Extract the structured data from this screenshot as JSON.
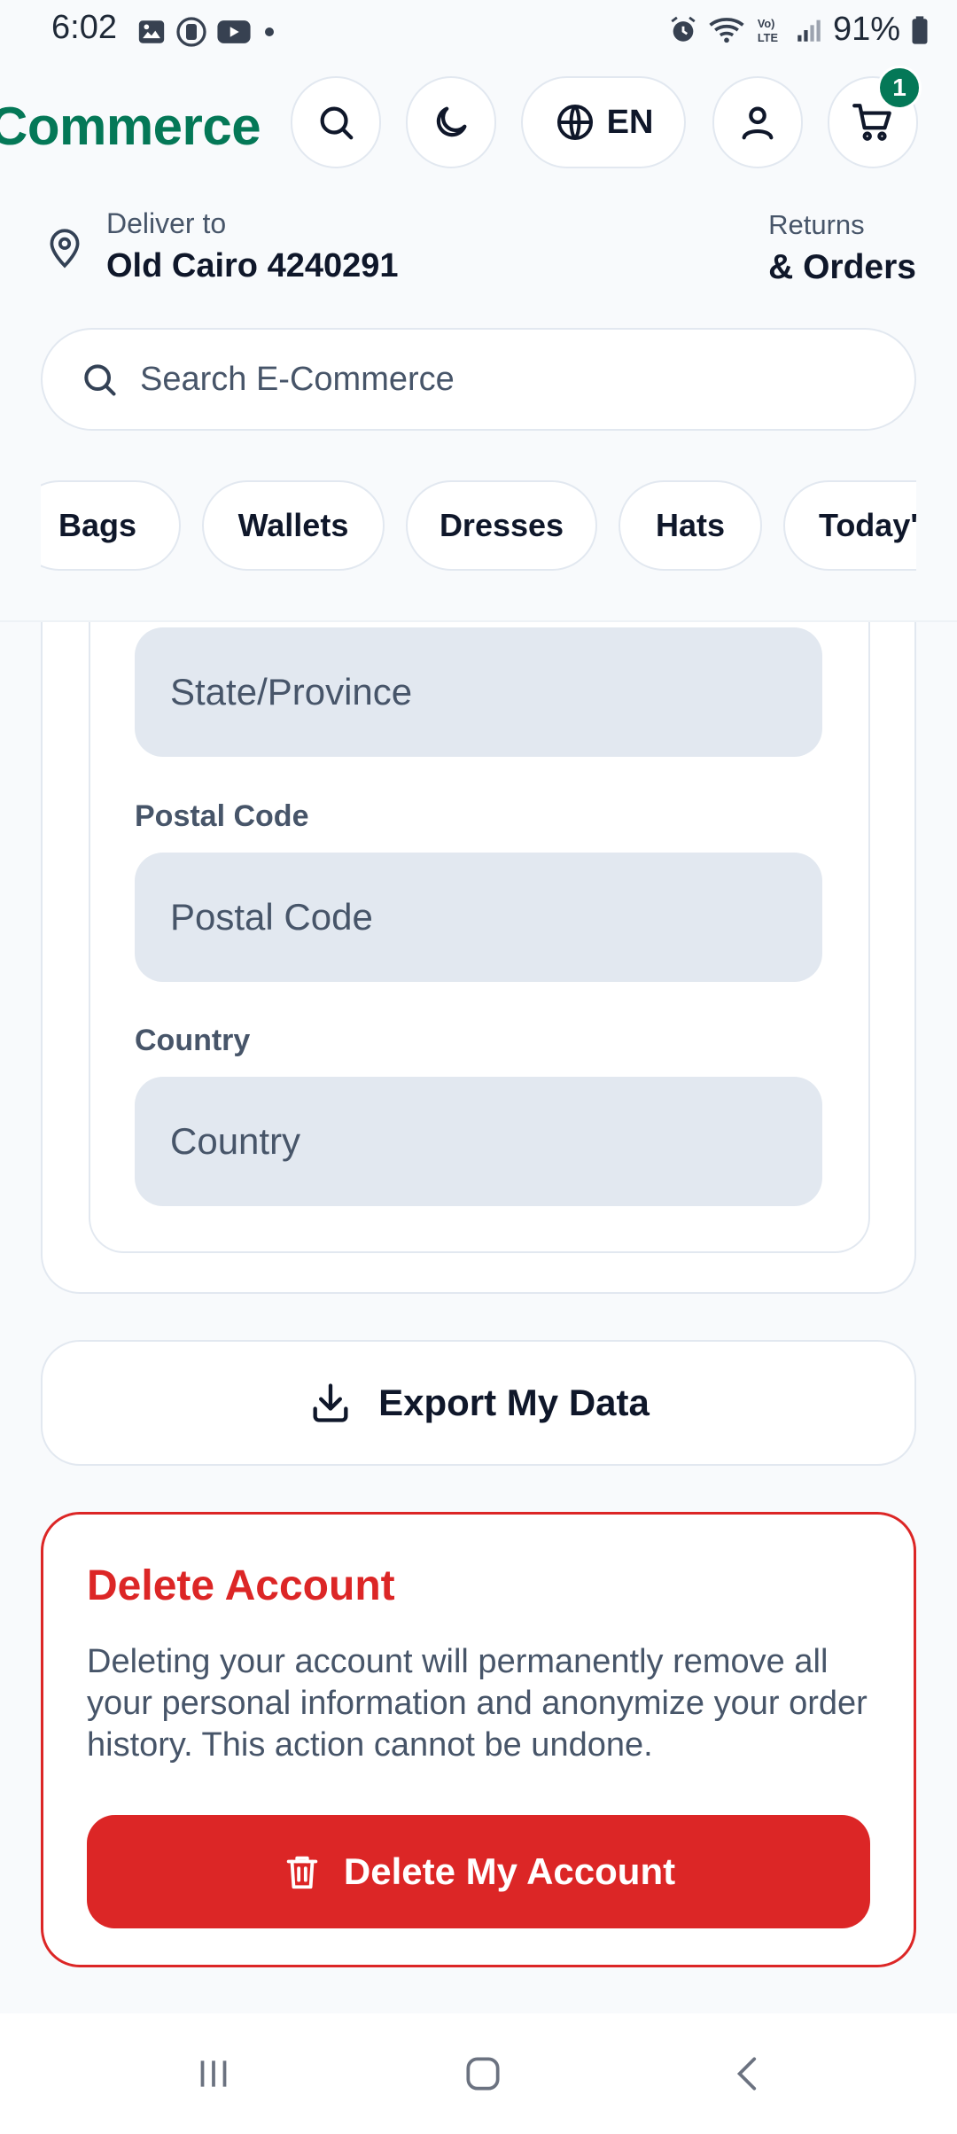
{
  "status_bar": {
    "time": "6:02",
    "battery": "91%",
    "icons": [
      "image-icon",
      "assistant-icon",
      "youtube-icon",
      "dot-icon",
      "alarm-icon",
      "wifi-icon",
      "volte-icon",
      "signal-icon",
      "battery-icon"
    ]
  },
  "header": {
    "brand": "Commerce",
    "language": "EN",
    "cart_count": "1",
    "deliver_label": "Deliver to",
    "deliver_location": "Old Cairo 4240291",
    "returns_label": "Returns",
    "orders_label": "& Orders",
    "search_placeholder": "Search E-Commerce",
    "categories": [
      "Bags",
      "Wallets",
      "Dresses",
      "Hats",
      "Today's"
    ]
  },
  "address_form": {
    "state": {
      "placeholder": "State/Province"
    },
    "postal": {
      "label": "Postal Code",
      "placeholder": "Postal Code"
    },
    "country": {
      "label": "Country",
      "placeholder": "Country"
    }
  },
  "export": {
    "label": "Export My Data"
  },
  "danger": {
    "title": "Delete Account",
    "description": "Deleting your account will permanently remove all your personal information and anonymize your order history. This action cannot be undone.",
    "button_label": "Delete My Account"
  },
  "colors": {
    "brand": "#047857",
    "danger": "#dc2626",
    "field_bg": "#e2e8f0",
    "text_muted": "#475569"
  }
}
